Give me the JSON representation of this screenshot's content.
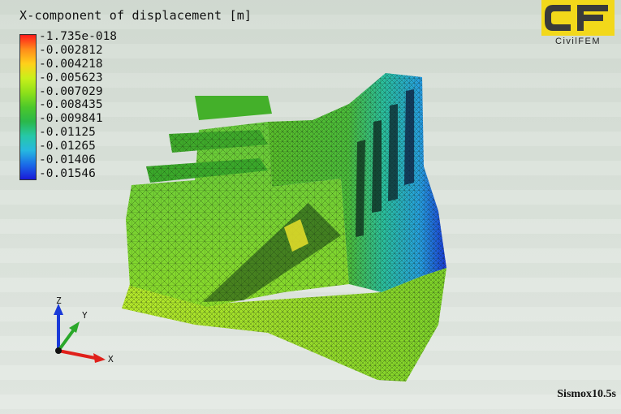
{
  "title": "X-component of displacement [m]",
  "legend": {
    "labels": [
      "-1.735e-018",
      "-0.002812",
      "-0.004218",
      "-0.005623",
      "-0.007029",
      "-0.008435",
      "-0.009841",
      "-0.01125",
      "-0.01265",
      "-0.01406",
      "-0.01546"
    ],
    "colors": [
      "#ff1a1a",
      "#ff8c1a",
      "#ffd11a",
      "#c8f01a",
      "#8ee01a",
      "#4cc82a",
      "#2ab84a",
      "#26c8a8",
      "#26b8e0",
      "#1a6ae8",
      "#1a1ad8"
    ]
  },
  "logo": {
    "text": "CivilFEM",
    "colors": {
      "dark": "#3a3a3a",
      "accent": "#f2d81a"
    }
  },
  "axes": {
    "x": "X",
    "y": "Y",
    "z": "Z"
  },
  "axis_colors": {
    "x": "#e0201a",
    "y": "#2aa82a",
    "z": "#1a3ad8"
  },
  "timestamp": "Sismox10.5s",
  "icons": [
    "civilfem-logo-icon",
    "axis-triad-icon"
  ]
}
